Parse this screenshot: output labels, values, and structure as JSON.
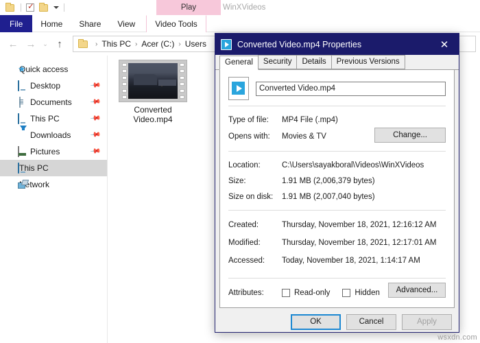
{
  "explorer": {
    "quick_access_toolbar": [
      {
        "name": "folder-icon",
        "label": "Folder"
      },
      {
        "name": "properties-check-icon",
        "label": "Properties"
      },
      {
        "name": "new-folder-icon",
        "label": "New folder"
      },
      {
        "name": "customize-caret-icon",
        "label": "Customize Quick Access Toolbar"
      }
    ],
    "contextual_group": {
      "label": "Play",
      "color": "#f7c8da"
    },
    "window_title": "WinXVideos",
    "ribbon_tabs": [
      {
        "label": "File",
        "selected": true,
        "color": "#1f1f8f"
      },
      {
        "label": "Home",
        "selected": false
      },
      {
        "label": "Share",
        "selected": false
      },
      {
        "label": "View",
        "selected": false
      },
      {
        "label": "Video Tools",
        "selected": false,
        "contextual": true
      }
    ],
    "nav_buttons": {
      "back": "←",
      "forward": "→",
      "recent": "⌄",
      "up": "↑"
    },
    "breadcrumb": [
      "This PC",
      "Acer (C:)",
      "Users"
    ],
    "breadcrumb_separator": "›",
    "nav_pane": [
      {
        "label": "Quick access",
        "icon": "star-pin-icon",
        "pinned": false,
        "selected": false,
        "child": false
      },
      {
        "label": "Desktop",
        "icon": "desktop-monitor-icon",
        "pinned": true,
        "selected": false,
        "child": true
      },
      {
        "label": "Documents",
        "icon": "documents-icon",
        "pinned": true,
        "selected": false,
        "child": true
      },
      {
        "label": "This PC",
        "icon": "this-pc-monitor-icon",
        "pinned": true,
        "selected": false,
        "child": true
      },
      {
        "label": "Downloads",
        "icon": "downloads-arrow-icon",
        "pinned": true,
        "selected": false,
        "child": true
      },
      {
        "label": "Pictures",
        "icon": "pictures-icon",
        "pinned": true,
        "selected": false,
        "child": true
      },
      {
        "label": "This PC",
        "icon": "this-pc-monitor-icon",
        "pinned": false,
        "selected": true,
        "child": false
      },
      {
        "label": "Network",
        "icon": "network-icon",
        "pinned": false,
        "selected": false,
        "child": false
      }
    ],
    "files": [
      {
        "name": "Converted\nVideo.mp4",
        "name_line1": "Converted",
        "name_line2": "Video.mp4",
        "type": "video-thumbnail"
      }
    ]
  },
  "dialog": {
    "title": "Converted Video.mp4 Properties",
    "title_icon": "mp4-file-icon",
    "close_label": "✕",
    "tabs": [
      {
        "label": "General",
        "selected": true
      },
      {
        "label": "Security",
        "selected": false
      },
      {
        "label": "Details",
        "selected": false
      },
      {
        "label": "Previous Versions",
        "selected": false
      }
    ],
    "filename_value": "Converted Video.mp4",
    "properties": [
      {
        "key": "Type of file:",
        "value": "MP4 File (.mp4)"
      },
      {
        "key": "Opens with:",
        "value": "Movies & TV",
        "button": "Change..."
      },
      {
        "key": "Location:",
        "value": "C:\\Users\\sayakboral\\Videos\\WinXVideos"
      },
      {
        "key": "Size:",
        "value": "1.91 MB (2,006,379 bytes)"
      },
      {
        "key": "Size on disk:",
        "value": "1.91 MB (2,007,040 bytes)"
      },
      {
        "key": "Created:",
        "value": "Thursday, November 18, 2021, 12:16:12 AM"
      },
      {
        "key": "Modified:",
        "value": "Thursday, November 18, 2021, 12:17:01 AM"
      },
      {
        "key": "Accessed:",
        "value": "Today, November 18, 2021, 1:14:17 AM"
      }
    ],
    "attributes": {
      "key": "Attributes:",
      "readonly_label": "Read-only",
      "readonly_checked": false,
      "hidden_label": "Hidden",
      "hidden_checked": false,
      "advanced_button": "Advanced..."
    },
    "footer": {
      "ok": "OK",
      "cancel": "Cancel",
      "apply": "Apply",
      "apply_disabled": true
    },
    "accent_color": "#1b87d2",
    "titlebar_color": "#1b1b6b"
  },
  "watermark": "wsxdn.com"
}
